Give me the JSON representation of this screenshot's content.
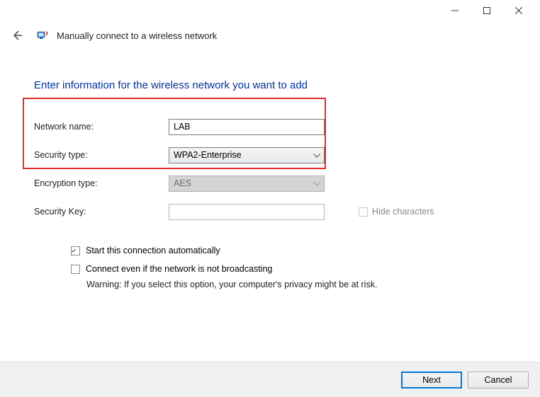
{
  "window": {
    "title": "Manually connect to a wireless network"
  },
  "instruction": "Enter information for the wireless network you want to add",
  "labels": {
    "network_name": "Network name:",
    "security_type": "Security type:",
    "encryption_type": "Encryption type:",
    "security_key": "Security Key:",
    "hide_characters": "Hide characters",
    "start_auto": "Start this connection automatically",
    "connect_even": "Connect even if the network is not broadcasting",
    "warning": "Warning: If you select this option, your computer's privacy might be at risk."
  },
  "values": {
    "network_name": "LAB",
    "security_type": "WPA2-Enterprise",
    "encryption_type": "AES",
    "security_key": "",
    "start_auto_checked": true,
    "connect_even_checked": false,
    "hide_characters_checked": false
  },
  "buttons": {
    "next": "Next",
    "cancel": "Cancel"
  }
}
